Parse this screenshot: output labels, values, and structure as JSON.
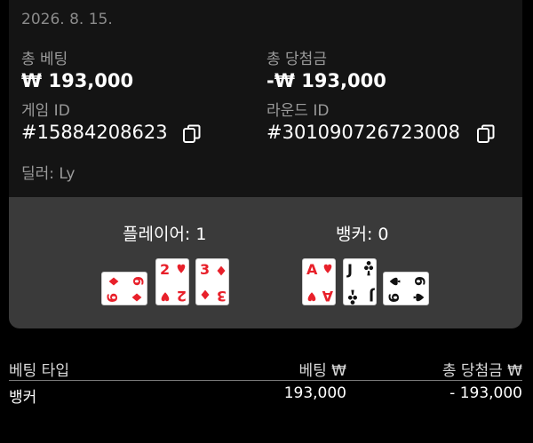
{
  "date": "2026. 8. 15.",
  "summary": {
    "total_bet_label": "총 베팅",
    "total_bet_value": "₩ 193,000",
    "total_win_label": "총 당첨금",
    "total_win_value": "-₩ 193,000",
    "game_id_label": "게임 ID",
    "game_id_value": "#15884208623",
    "round_id_label": "라운드 ID",
    "round_id_value": "#301090726723008",
    "dealer_label": "딜러: Ly"
  },
  "cards": {
    "player_title": "플레이어: 1",
    "banker_title": "뱅커: 0",
    "player_hand": [
      {
        "rank": "6",
        "suit": "diamond",
        "color": "#e8202a",
        "rotated": true
      },
      {
        "rank": "2",
        "suit": "heart",
        "color": "#e8202a",
        "rotated": false
      },
      {
        "rank": "3",
        "suit": "diamond",
        "color": "#e8202a",
        "rotated": false
      }
    ],
    "banker_hand": [
      {
        "rank": "A",
        "suit": "heart",
        "color": "#e8202a",
        "rotated": false
      },
      {
        "rank": "J",
        "suit": "club",
        "color": "#111111",
        "rotated": false
      },
      {
        "rank": "6",
        "suit": "spade",
        "color": "#111111",
        "rotated": true
      }
    ]
  },
  "table": {
    "headers": [
      "베팅 타입",
      "베팅 ₩",
      "총 당첨금 ₩"
    ],
    "rows": [
      [
        "뱅커",
        "193,000",
        "- 193,000"
      ]
    ]
  }
}
